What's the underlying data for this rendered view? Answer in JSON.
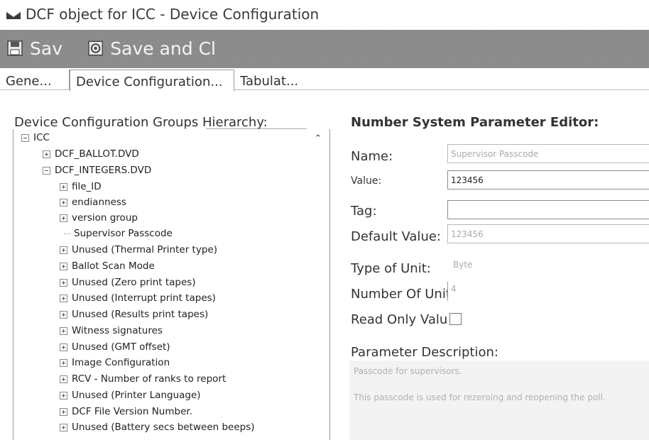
{
  "window": {
    "title": "DCF object for ICC - Device Configuration"
  },
  "toolbar": {
    "save_label": "Sav",
    "save_close_label": "Save and Cl"
  },
  "tabs": [
    {
      "label": "Gene..."
    },
    {
      "label": "Device Configuration..."
    },
    {
      "label": "Tabulat..."
    }
  ],
  "hierarchy": {
    "label": "Device Configuration Groups Hierarchy:",
    "root": "ICC",
    "ballot": "DCF_BALLOT.DVD",
    "integers": "DCF_INTEGERS.DVD",
    "items": [
      "file_ID",
      "endianness",
      "version group",
      "Supervisor Passcode",
      "Unused (Thermal Printer type)",
      "Ballot Scan Mode",
      "Unused (Zero print tapes)",
      "Unused (Interrupt print tapes)",
      "Unused (Results print tapes)",
      "Witness signatures",
      "Unused (GMT offset)",
      "Image Configuration",
      "RCV - Number of ranks to report",
      "Unused (Printer Language)",
      "DCF File Version Number.",
      "Unused (Battery secs between beeps)"
    ]
  },
  "editor": {
    "title": "Number System Parameter Editor:",
    "name_label": "Name:",
    "name_value": "Supervisor Passcode",
    "value_label": "Value:",
    "value_value": "123456",
    "tag_label": "Tag:",
    "tag_value": "",
    "default_label": "Default Value:",
    "default_value": "123456",
    "unit_type_label": "Type of Unit:",
    "unit_type_value": "Byte",
    "unit_count_label": "Number Of Unit",
    "unit_count_value": "4",
    "readonly_label": "Read Only Valu",
    "readonly_checked": false,
    "description_label": "Parameter Description:",
    "description_line1": "Passcode for supervisors.",
    "description_line2": "This passcode is used for rezeroing and reopening the poll."
  }
}
